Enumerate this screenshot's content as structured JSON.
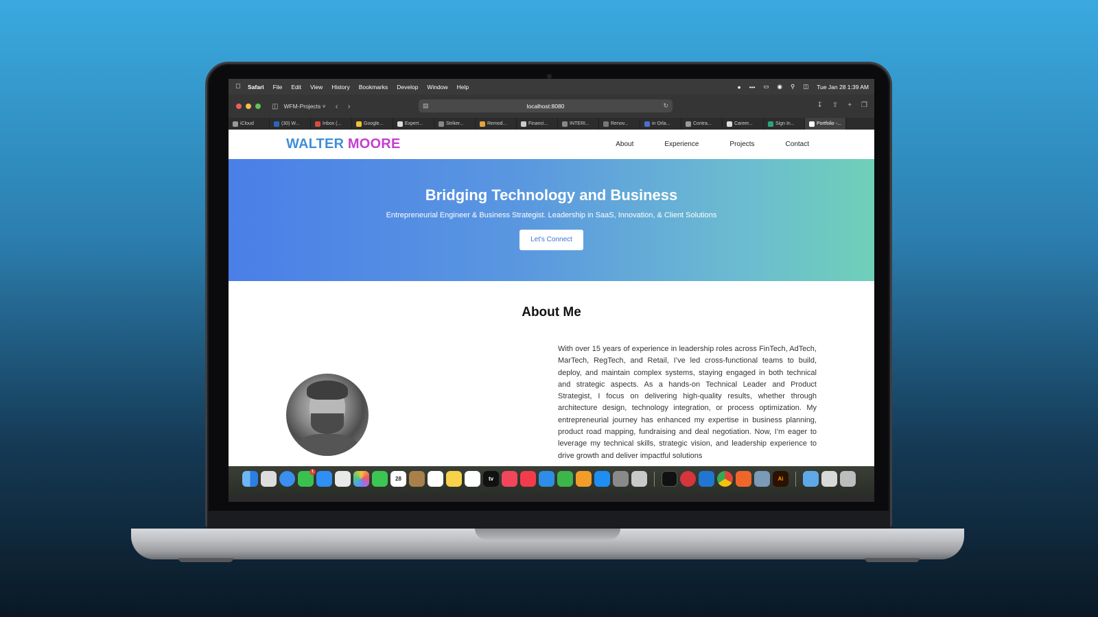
{
  "menubar": {
    "items": [
      "Safari",
      "File",
      "Edit",
      "View",
      "History",
      "Bookmarks",
      "Develop",
      "Window",
      "Help"
    ],
    "clock": "Tue Jan 28  1:39 AM"
  },
  "toolbar": {
    "tab_group": "WFM-Projects",
    "url": "localhost:8080"
  },
  "tabs": [
    "iCloud",
    "(30) W...",
    "Inbox (...",
    "Google...",
    "Expert...",
    "Striker...",
    "Remod...",
    "Financi...",
    "INTERI...",
    "Renov...",
    "in Orla...",
    "Contra...",
    "Career...",
    "Sign In...",
    "Portfolio -..."
  ],
  "site": {
    "logo_first": "WALTER",
    "logo_last": "MOORE",
    "nav": [
      "About",
      "Experience",
      "Projects",
      "Contact"
    ],
    "hero_title": "Bridging Technology and Business",
    "hero_subtitle": "Entrepreneurial Engineer & Business Strategist. Leadership in SaaS, Innovation, & Client Solutions",
    "cta": "Let's Connect",
    "about_title": "About Me",
    "about_text": "With over 15 years of experience in leadership roles across FinTech, AdTech, MarTech, RegTech, and Retail, I’ve led cross-functional teams to build, deploy, and maintain complex systems, staying engaged in both technical and strategic aspects. As a hands-on Technical Leader and Product Strategist, I focus on delivering high-quality results, whether through architecture design, technology integration, or process optimization. My entrepreneurial journey has enhanced my expertise in business planning, product road mapping, fundraising and deal negotiation. Now, I’m eager to leverage my technical skills, strategic vision, and leadership experience to drive growth and deliver impactful solutions"
  },
  "dock": {
    "calendar_day": "28",
    "tv_label": "tv",
    "ai_label": "Ai",
    "messages_badge": "1"
  },
  "colors": {
    "logo_first": "#3f8fd8",
    "logo_last": "#c43dd1",
    "hero_gradient_start": "#4a7fe8",
    "hero_gradient_end": "#6fd0b8",
    "cta_text": "#3c72d4"
  }
}
